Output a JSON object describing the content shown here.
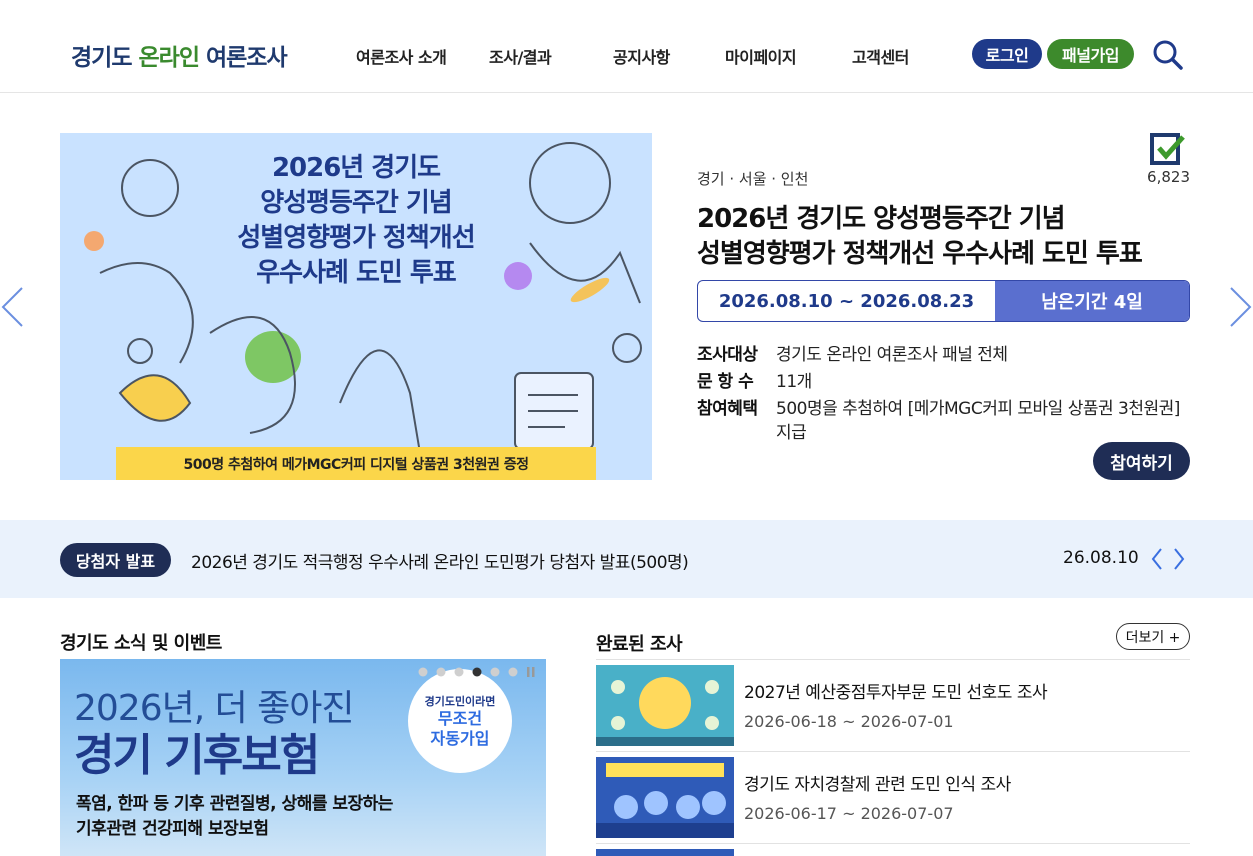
{
  "header": {
    "logo_part1": "경기도 ",
    "logo_part2": "온라인",
    "logo_part3": " 여론조사",
    "nav": [
      "여론조사 소개",
      "조사/결과",
      "공지사항",
      "마이페이지",
      "고객센터"
    ],
    "login": "로그인",
    "join": "패널가입"
  },
  "hero": {
    "image_title_line1": "2026년 경기도",
    "image_title_line2": "양성평등주간 기념",
    "image_title_line3": "성별영향평가 정책개선",
    "image_title_line4": "우수사례 도민 투표",
    "image_banner": "500명 추첨하여 메가MGC커피 디지털 상품권 3천원권 증정",
    "region": "경기 · 서울 · 인천",
    "count": "6,823",
    "title_line1": "2026년 경기도 양성평등주간 기념",
    "title_line2": "성별영향평가 정책개선 우수사례 도민 투표",
    "period": "2026.08.10 ~ 2026.08.23",
    "remaining": "남은기간 4일",
    "target_label": "조사대상",
    "target_value": "경기도 온라인 여론조사 패널 전체",
    "questions_label": "문 항 수",
    "questions_value": "11개",
    "benefit_label": "참여혜택",
    "benefit_value": "500명을 추첨하여 [메가MGC커피 모바일 상품권 3천원권] 지급",
    "participate": "참여하기"
  },
  "notice": {
    "badge": "당첨자 발표",
    "text": "2026년 경기도 적극행정 우수사례 온라인 도민평가 당첨자 발표(500명)",
    "date": "26.08.10"
  },
  "news": {
    "title": "경기도 소식 및 이벤트",
    "year_line": "2026년, 더 좋아진",
    "big_line": "경기 기후보험",
    "bubble_small": "경기도민이라면",
    "bubble_line1": "무조건",
    "bubble_line2": "자동가입",
    "sub_line1": "폭염, 한파 등 기후 관련질병, 상해를 보장하는",
    "sub_line2": "기후관련 건강피해 보장보험"
  },
  "completed": {
    "title": "완료된 조사",
    "more": "더보기 +",
    "items": [
      {
        "title": "2027년 예산중점투자부문 도민 선호도 조사",
        "date": "2026-06-18 ~ 2026-07-01"
      },
      {
        "title": "경기도 자치경찰제 관련 도민 인식 조사",
        "date": "2026-06-17 ~ 2026-07-07"
      }
    ]
  },
  "colors": {
    "brand_navy": "#1f3a8a",
    "brand_green": "#3d8a2c",
    "accent_blue": "#5a6fcf",
    "notice_bg": "#eaf2fc"
  }
}
